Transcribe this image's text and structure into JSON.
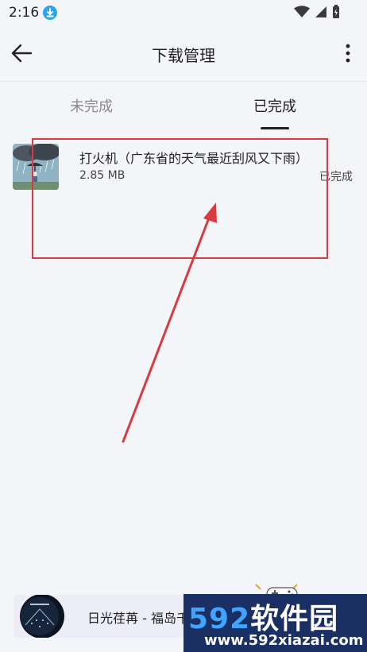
{
  "status_bar": {
    "time": "2:16"
  },
  "app_bar": {
    "title": "下载管理"
  },
  "tabs": [
    {
      "label": "未完成",
      "active": false
    },
    {
      "label": "已完成",
      "active": true
    }
  ],
  "downloads": [
    {
      "title": "打火机（广东省的天气最近刮风又下雨）",
      "size": "2.85 MB",
      "status": "已完成"
    }
  ],
  "player": {
    "title": "日光荏苒 - 福岛千"
  },
  "watermark": {
    "brand_num": "592",
    "brand_text": "软件园",
    "url": "www.592xiazai.com"
  },
  "colors": {
    "background": "#f4f5f9",
    "annotation": "#d83a3f",
    "tab_active": "#222222",
    "tab_inactive": "#8a8a8a"
  }
}
